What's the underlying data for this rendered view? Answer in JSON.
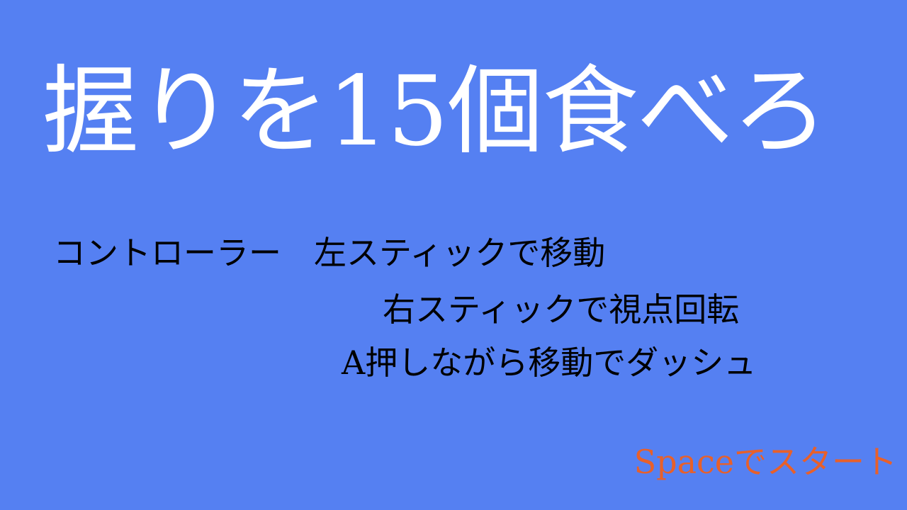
{
  "screen": {
    "title": "握りを15個食べろ",
    "controls": {
      "line1": "コントローラー　左スティックで移動",
      "line2": "右スティックで視点回転",
      "line3": "A押しながら移動でダッシュ"
    },
    "start_prompt": "Spaceでスタート"
  },
  "colors": {
    "background": "#5580f2",
    "title_text": "#ffffff",
    "controls_text": "#000000",
    "start_text": "#e8602a"
  }
}
